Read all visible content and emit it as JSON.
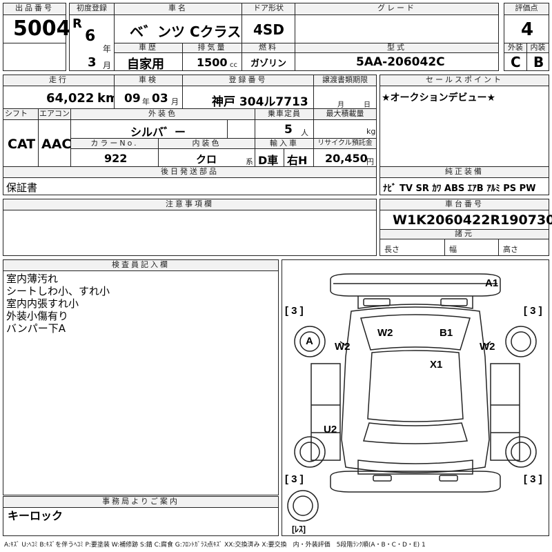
{
  "lot": {
    "label": "出品番号",
    "value": "5004"
  },
  "first_reg": {
    "label": "初度登録",
    "era": "R",
    "year": "6",
    "year_unit": "年",
    "month": "3",
    "month_unit": "月"
  },
  "car_name": {
    "label": "車名",
    "value": "ベ゛ンツ Cクラス"
  },
  "door": {
    "label": "ドア形状",
    "value": "4SD"
  },
  "grade": {
    "label": "グレード",
    "value": ""
  },
  "score": {
    "label": "評価点",
    "value": "4"
  },
  "history": {
    "label": "車歴",
    "value": "自家用"
  },
  "displacement": {
    "label": "排気量",
    "value": "1500",
    "unit": "cc"
  },
  "fuel": {
    "label": "燃料",
    "value": "ガゾリン"
  },
  "model": {
    "label": "型式",
    "value": "5AA-206042C"
  },
  "exterior": {
    "label": "外装",
    "value": "C"
  },
  "interior": {
    "label": "内装",
    "value": "B"
  },
  "mileage": {
    "label": "走行",
    "value": "64,022",
    "unit": "km"
  },
  "inspection": {
    "label": "車検",
    "year": "09",
    "year_unit": "年",
    "month": "03",
    "month_unit": "月"
  },
  "registration": {
    "label": "登録番号",
    "value": "神戸 304ル7713"
  },
  "transfer": {
    "label": "譲渡書類期限",
    "month_unit": "月",
    "day_unit": "日"
  },
  "selling_point": {
    "label": "セールスポイント",
    "value": "★オークションデビュー★"
  },
  "shift": {
    "label": "シフト",
    "value": "CAT"
  },
  "aircon": {
    "label": "エアコン",
    "value": "AAC"
  },
  "ext_color": {
    "label": "外装色",
    "value": "シルバ゛ー"
  },
  "capacity": {
    "label": "乗車定員",
    "value": "5",
    "unit": "人"
  },
  "max_load": {
    "label": "最大積載量",
    "value": "",
    "unit": "kg"
  },
  "color_no": {
    "label": "カラーNo.",
    "value": "922"
  },
  "int_color": {
    "label": "内装色",
    "value": "クロ",
    "unit": "系"
  },
  "import": {
    "label": "輸入車",
    "value1": "D車",
    "value2": "右H"
  },
  "recycle": {
    "label": "リサイクル預託金",
    "value": "20,450",
    "unit": "円"
  },
  "later_parts": {
    "label": "後日発送部品",
    "value": "保証書"
  },
  "equipment": {
    "label": "純正装備",
    "value": "ﾅﾋﾞ TV SR ｶﾜ ABS ｴｱB ｱﾙﾐ PS PW"
  },
  "caution": {
    "label": "注意事項欄",
    "value": ""
  },
  "chassis": {
    "label": "車台番号",
    "value": "W1K2060422R190730"
  },
  "dims": {
    "label": "諸元",
    "length": "長さ",
    "width": "幅",
    "height": "高さ"
  },
  "inspector": {
    "label": "検査員記入欄",
    "lines": [
      "室内薄汚れ",
      "シートしわ小、すれ小",
      "室内内張すれ小",
      "外装小傷有り",
      "バンパー下A"
    ]
  },
  "office": {
    "label": "事務局よりご案内",
    "value": "キーロック"
  },
  "diagram": {
    "marks": {
      "a1": "A1",
      "w2_left": "W2",
      "w2_top": "W2",
      "b1": "B1",
      "w2_right": "W2",
      "x1": "X1",
      "a": "A",
      "u2": "U2"
    },
    "tires": {
      "tl": "[ 3 ]",
      "tr": "[ 3 ]",
      "bl": "[ 3 ]",
      "br": "[ 3 ]",
      "spare": "[ﾚｽ]"
    }
  },
  "legend": "A:ｷｽﾞ U:ﾍｺﾐ B:ｷｽﾞを伴うﾍｺﾐ P:要塗装 W:補修跡 S:錆 C:腐食 G:ﾌﾛﾝﾄｶﾞﾗｽ点ｷｽﾞ XX:交換済み X:要交換　内・外装評価　5段階ﾗﾝｸ順(A・B・C・D・E) 1"
}
